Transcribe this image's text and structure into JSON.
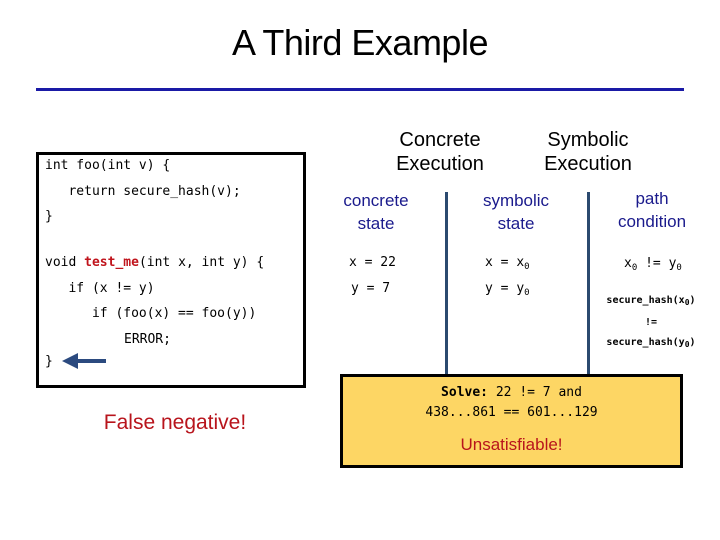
{
  "slide": {
    "title": "A Third Example"
  },
  "code": {
    "lines": [
      "int foo(int v) {",
      "   return secure_hash(v);",
      "}",
      "void ",
      "test_me",
      "(int x, int y) {",
      "   if (x != y)",
      "      if (foo(x) == foo(y))",
      "ERROR;",
      "}"
    ],
    "arrow_icon": "arrow-left-icon"
  },
  "annotation": {
    "false_negative": "False negative!"
  },
  "execution": {
    "concrete_header": [
      "Concrete",
      "Execution"
    ],
    "symbolic_header": [
      "Symbolic",
      "Execution"
    ],
    "columns": {
      "concrete_state": [
        "concrete",
        "state"
      ],
      "symbolic_state": [
        "symbolic",
        "state"
      ],
      "path_condition": [
        "path",
        "condition"
      ]
    },
    "concrete_values": [
      "x = 22",
      "y = 7"
    ],
    "symbolic_values": [
      {
        "var": "x = ",
        "sym": "x",
        "sub": "0"
      },
      {
        "var": "y = ",
        "sym": "y",
        "sub": "0"
      }
    ],
    "path_condition": {
      "cond1": {
        "left": "x",
        "left_sub": "0",
        "op": " != ",
        "right": "y",
        "right_sub": "0"
      },
      "hash_left": "secure_hash(x",
      "hash_left_sub": "0",
      "hash_op": "!=",
      "hash_right": "secure_hash(y",
      "hash_right_sub": "0",
      "close_paren": ")"
    }
  },
  "solver": {
    "solve_label": "Solve:",
    "line1_rest": " 22 != 7 and",
    "line2": "438...861 == 601...129",
    "result": "Unsatisfiable!"
  },
  "colors": {
    "title_rule": "#1a1aa6",
    "highlight_red": "#c0141c",
    "column_header": "#1a1a8c",
    "divider": "#2b4a6f",
    "solver_bg": "#fdd664"
  }
}
